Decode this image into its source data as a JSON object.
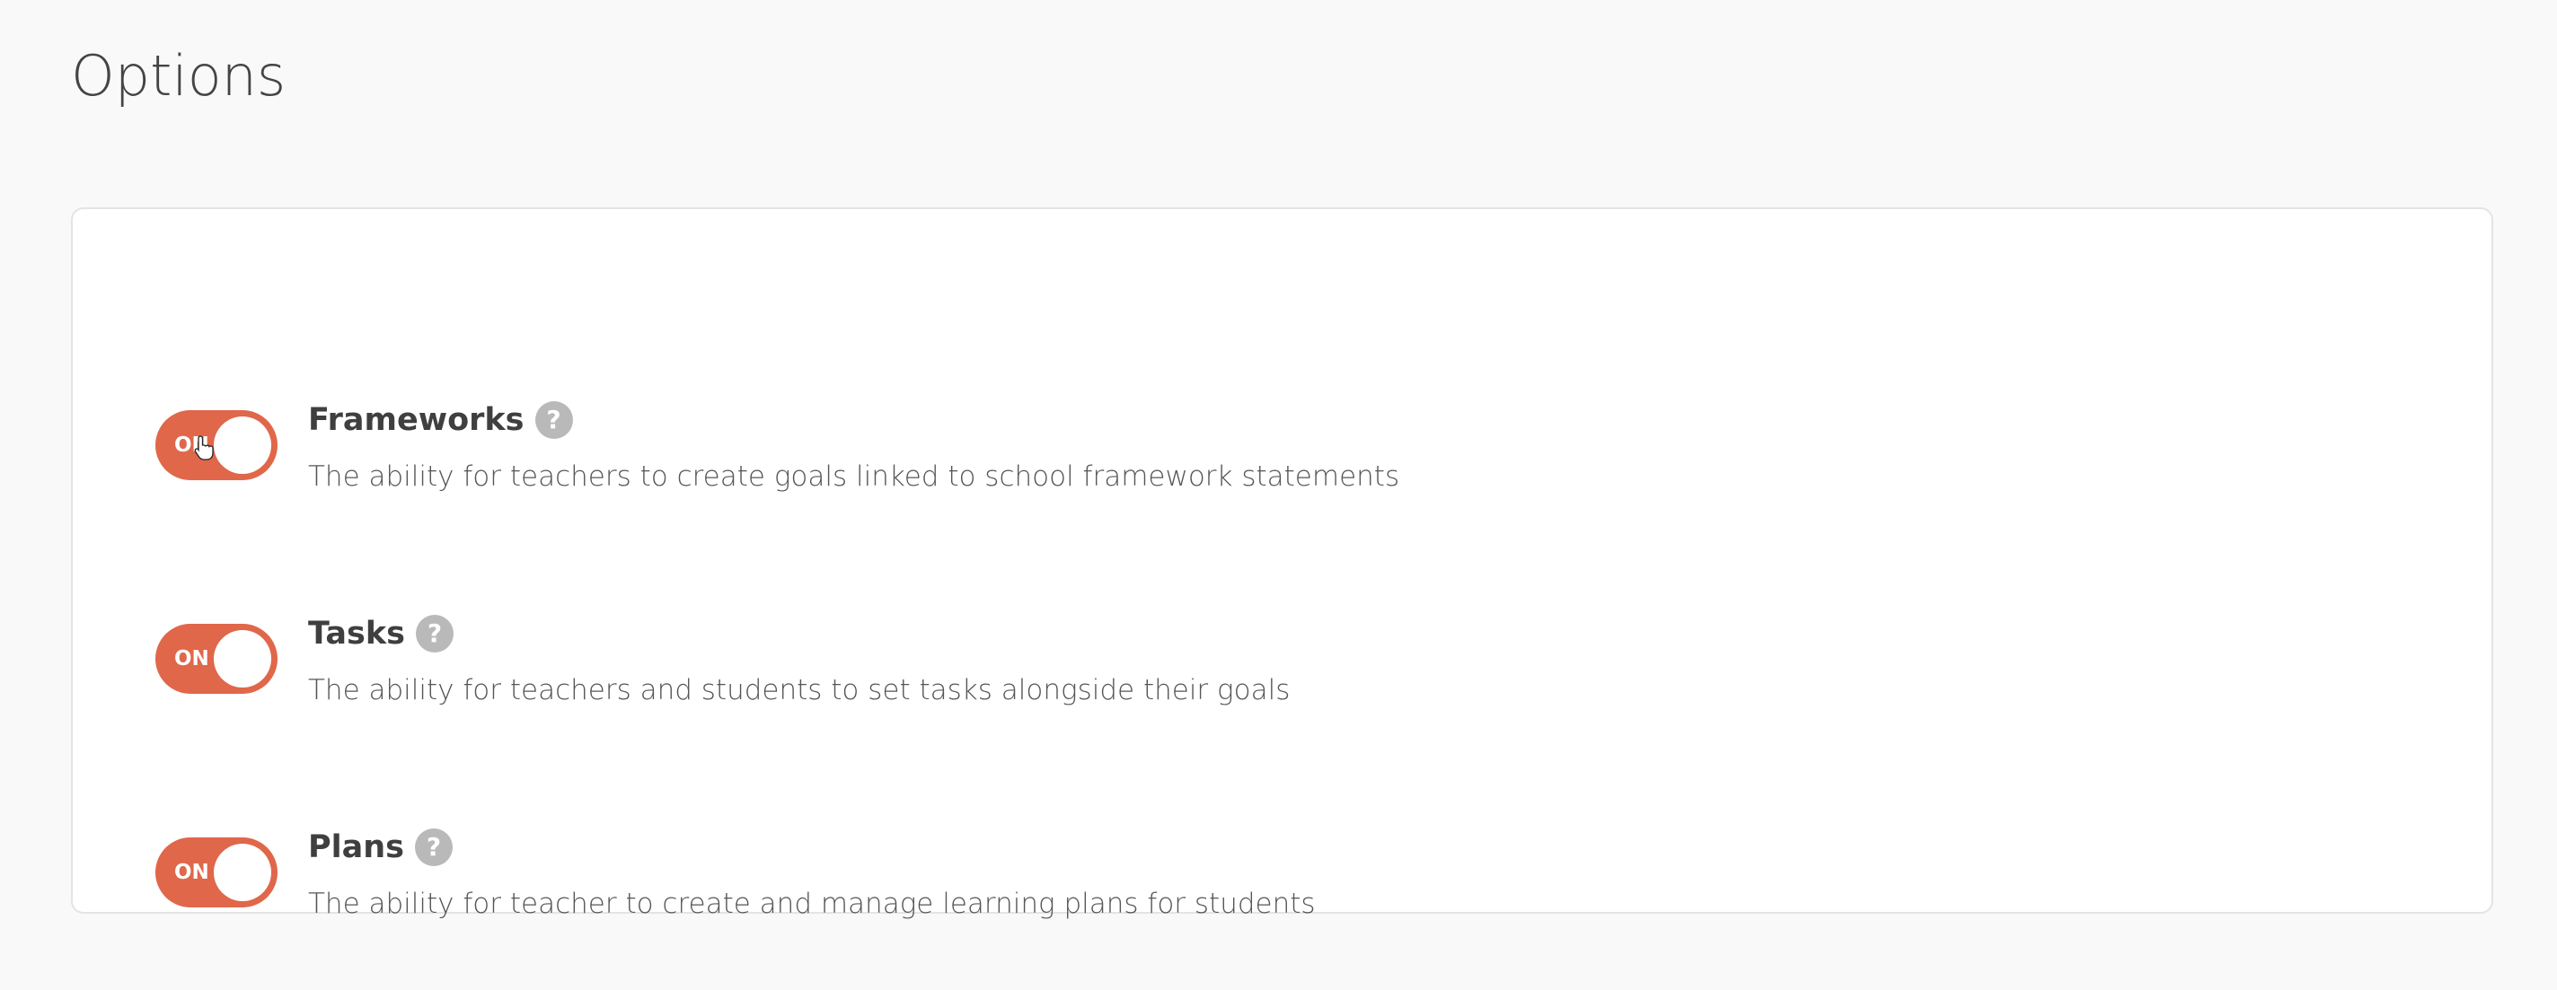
{
  "page": {
    "title": "Options"
  },
  "options": [
    {
      "title": "Frameworks",
      "description": "The ability for teachers to create goals linked to school framework statements",
      "toggle_label": "ON",
      "enabled": true,
      "help_icon": "?"
    },
    {
      "title": "Tasks",
      "description": "The ability for teachers and students to set tasks alongside their goals",
      "toggle_label": "ON",
      "enabled": true,
      "help_icon": "?"
    },
    {
      "title": "Plans",
      "description": "The ability for teacher to create and manage learning plans for students",
      "toggle_label": "ON",
      "enabled": true,
      "help_icon": "?"
    }
  ],
  "colors": {
    "toggle_on": "#e0674a",
    "help_icon": "#b9b9b9",
    "background": "#f9f9f9",
    "panel": "#ffffff"
  }
}
